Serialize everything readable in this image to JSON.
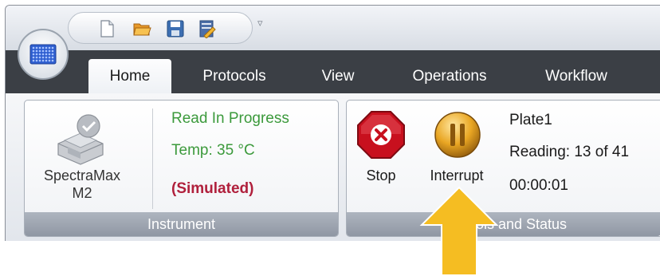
{
  "tabs": [
    {
      "label": "Home",
      "active": true
    },
    {
      "label": "Protocols"
    },
    {
      "label": "View"
    },
    {
      "label": "Operations"
    },
    {
      "label": "Workflow"
    }
  ],
  "quick_access": {
    "icons": [
      "new-file-icon",
      "open-folder-icon",
      "save-icon",
      "edit-protocol-icon"
    ],
    "more": "▿"
  },
  "instrument": {
    "name": "SpectraMax M2",
    "status": "Read In Progress",
    "temp": "Temp: 35 °C",
    "mode": "(Simulated)",
    "group_label": "Instrument"
  },
  "controls": {
    "stop_label": "Stop",
    "interrupt_label": "Interrupt",
    "plate": "Plate1",
    "reading": "Reading: 13 of 41",
    "elapsed": "00:00:01",
    "group_label": "Controls and Status"
  },
  "colors": {
    "status_green": "#3c9a3c",
    "simulated_red": "#b0203c",
    "stop_red": "#c8101e",
    "arrow_yellow": "#f5bd22"
  }
}
